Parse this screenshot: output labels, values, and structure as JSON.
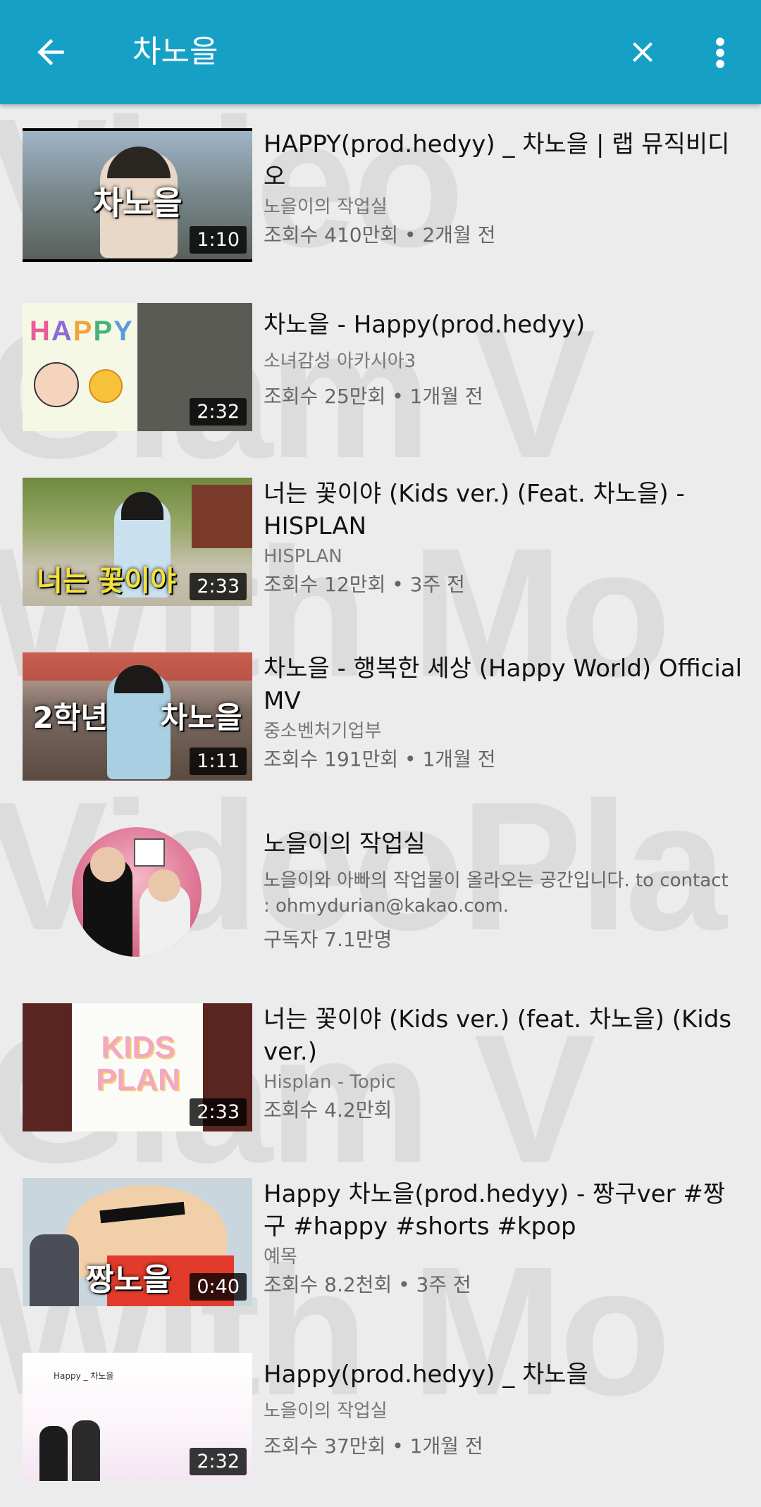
{
  "appbar": {
    "title": "차노을",
    "back_icon": "arrow-left-icon",
    "close_icon": "close-icon",
    "more_icon": "more-vert-icon",
    "color": "#17a0c6"
  },
  "watermark": [
    "Video",
    "Glam V",
    "With Mo",
    "VideoPla",
    "Glam V",
    "With Mo"
  ],
  "results": [
    {
      "title": "HAPPY(prod.hedyy) _ 차노을 | 랩 뮤직비디오",
      "channel": "노을이의 작업실",
      "meta": "조회수 410만회 • 2개월 전",
      "duration": "1:10",
      "overlay": "차노을"
    },
    {
      "title": "차노을 - Happy(prod.hedyy)",
      "channel": "소녀감성 아카시아3",
      "meta": "조회수 25만회 • 1개월 전",
      "duration": "2:32",
      "overlay": "HAPPY"
    },
    {
      "title": "너는 꽃이야 (Kids ver.) (Feat. 차노을) - HISPLAN",
      "channel": "HISPLAN",
      "meta": "조회수 12만회 • 3주 전",
      "duration": "2:33",
      "overlay": "너는 꽃이야"
    },
    {
      "title": "차노을 - 행복한 세상 (Happy World) Official MV",
      "channel": "중소벤처기업부",
      "meta": "조회수 191만회 • 1개월 전",
      "duration": "1:11",
      "overlay": "2학년 차노을"
    }
  ],
  "channel_result": {
    "name": "노을이의 작업실",
    "desc": "노을이와 아빠의 작업물이 올라오는 공간입니다. to contact : ohmydurian@kakao.com.",
    "subs": "구독자 7.1만명"
  },
  "results2": [
    {
      "title": "너는 꽃이야 (Kids ver.) (feat. 차노을) (Kids ver.)",
      "channel": "Hisplan - Topic",
      "meta": "조회수 4.2만회",
      "duration": "2:33",
      "overlay": "KIDS PLAN"
    },
    {
      "title": "Happy 차노을(prod.hedyy) - 짱구ver #짱구 #happy #shorts #kpop",
      "channel": "예목",
      "meta": "조회수 8.2천회 • 3주 전",
      "duration": "0:40",
      "overlay": "짱노을"
    },
    {
      "title": "Happy(prod.hedyy) _ 차노을",
      "channel": "노을이의 작업실",
      "meta": "조회수 37만회 • 1개월 전",
      "duration": "2:32",
      "overlay": "Happy _ 차노을"
    }
  ]
}
